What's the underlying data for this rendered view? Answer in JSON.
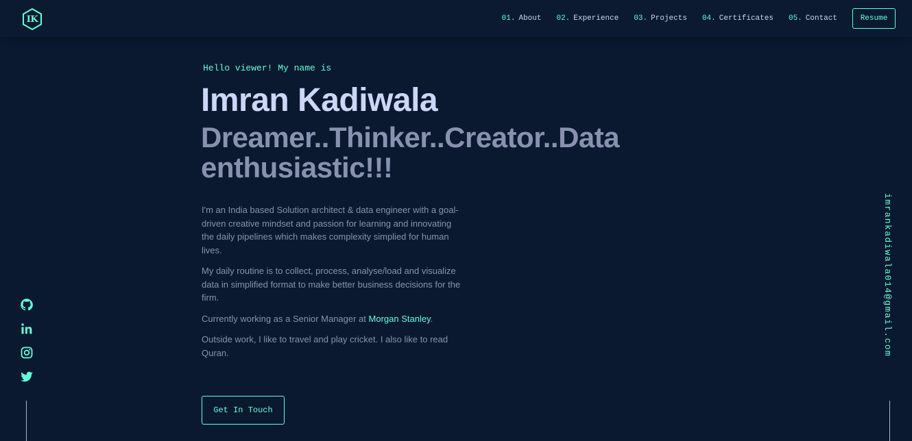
{
  "logo": {
    "text": "IK"
  },
  "nav": {
    "items": [
      {
        "num": "01.",
        "label": "About"
      },
      {
        "num": "02.",
        "label": "Experience"
      },
      {
        "num": "03.",
        "label": "Projects"
      },
      {
        "num": "04.",
        "label": "Certificates"
      },
      {
        "num": "05.",
        "label": "Contact"
      }
    ],
    "resume_label": "Resume"
  },
  "hero": {
    "greeting": "Hello viewer! My name is",
    "name": "Imran Kadiwala",
    "tagline": "Dreamer..Thinker..Creator..Data enthusiastic!!!",
    "bio": {
      "p1": "I'm an India based Solution architect & data engineer with a goal-driven creative mindset and passion for learning and innovating the daily pipelines which makes complexity simplied for human lives.",
      "p2": "My daily routine is to collect, process, analyse/load and visualize data in simplified format to make better business decisions for the firm.",
      "p3_prefix": "Currently working as a Senior Manager at ",
      "p3_link": "Morgan Stanley",
      "p3_suffix": ".",
      "p4": "Outside work, I like to travel and play cricket. I also like to read Quran."
    },
    "cta_label": "Get In Touch"
  },
  "social": {
    "icons": [
      "github-icon",
      "linkedin-icon",
      "instagram-icon",
      "twitter-icon"
    ]
  },
  "email": "imrankadiwala014@gmail.com",
  "colors": {
    "background": "#0a192f",
    "accent": "#64ffda",
    "heading": "#ccd6f6",
    "body_text": "#8892b0"
  }
}
